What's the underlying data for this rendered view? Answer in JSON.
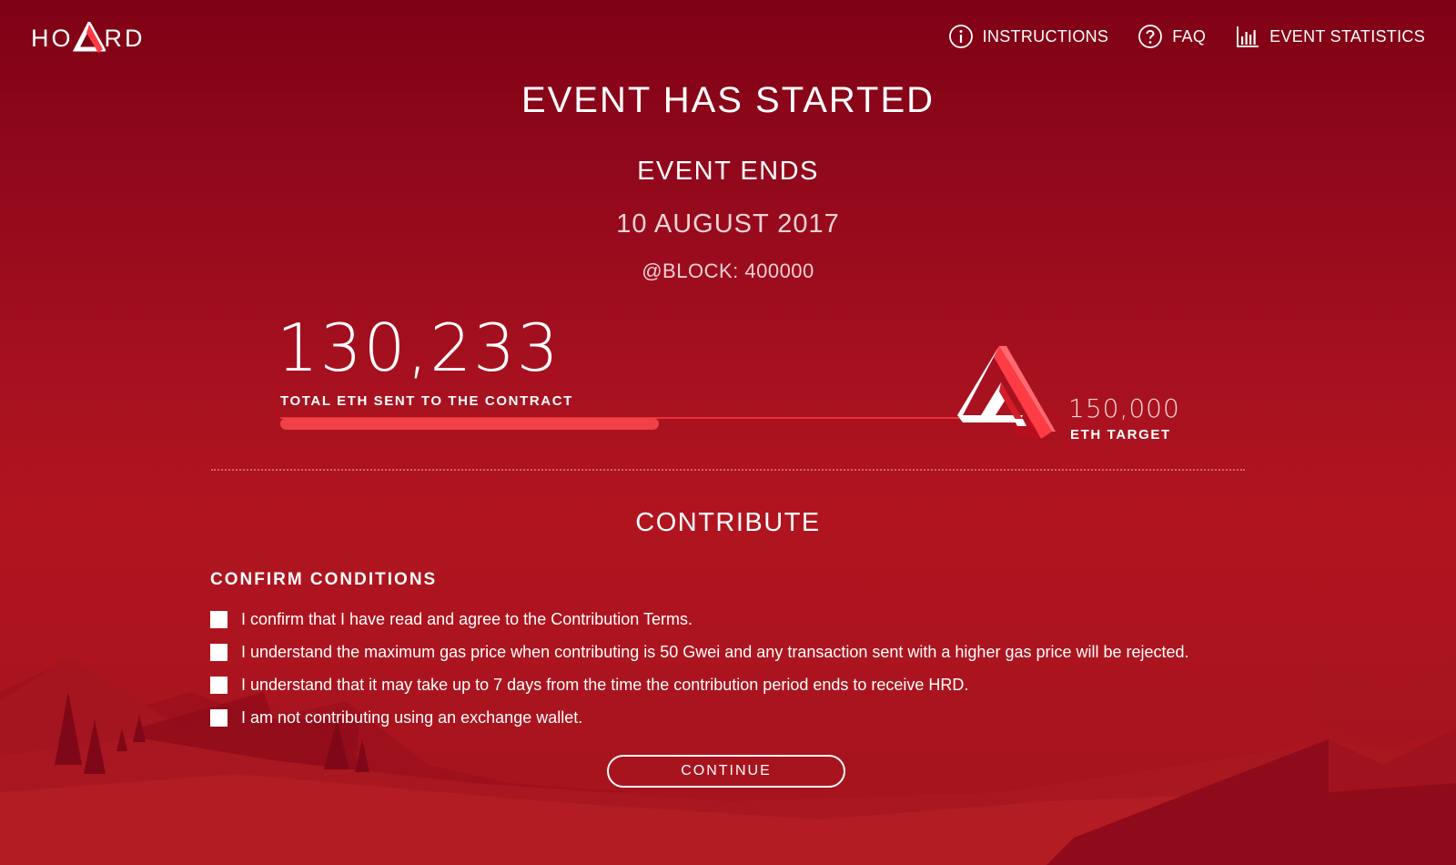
{
  "header": {
    "logo_left": "HO",
    "logo_right": "RD",
    "nav": [
      {
        "label": "INSTRUCTIONS",
        "icon": "info-icon"
      },
      {
        "label": "FAQ",
        "icon": "question-icon"
      },
      {
        "label": "EVENT STATISTICS",
        "icon": "bar-chart-icon"
      }
    ]
  },
  "event": {
    "title": "EVENT HAS STARTED",
    "ends_label": "EVENT ENDS",
    "end_date": "10 AUGUST 2017",
    "block": "@BLOCK: 400000"
  },
  "progress": {
    "total": "130,233",
    "total_label": "TOTAL ETH SENT TO THE CONTRACT",
    "target": "150,000",
    "target_label": "ETH TARGET",
    "fill_fraction": 0.52
  },
  "contribute": {
    "title": "CONTRIBUTE",
    "conditions_title": "CONFIRM CONDITIONS",
    "conditions": [
      "I confirm that I have read and agree to the Contribution Terms.",
      "I understand the maximum gas price when contributing is 50 Gwei and any transaction sent with a higher gas price will be rejected.",
      "I understand that it may take up to 7 days from the time the contribution period ends to receive HRD.",
      "I am not contributing using an exchange wallet."
    ],
    "continue_label": "CONTINUE"
  },
  "colors": {
    "background_top": "#7f0115",
    "background_bottom": "#b0151f",
    "accent": "#f04048",
    "text": "#ffffff"
  }
}
